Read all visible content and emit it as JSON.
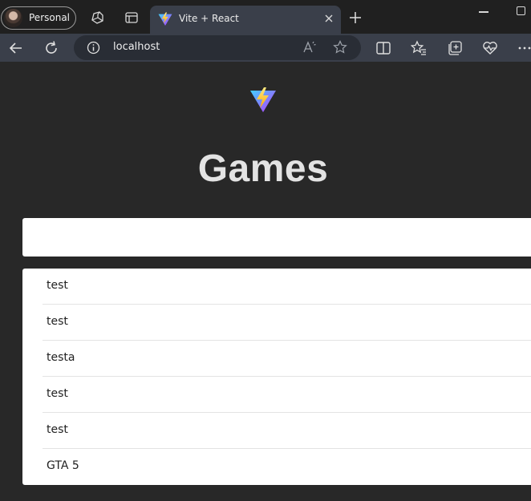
{
  "browser": {
    "profile_label": "Personal",
    "tab_title": "Vite + React",
    "address": "localhost",
    "icons": [
      "avatar",
      "workspaces-icon",
      "tab-actions-icon",
      "vite-favicon-icon",
      "close-icon",
      "new-tab-icon",
      "minimize-icon",
      "maximize-icon",
      "back-icon",
      "refresh-icon",
      "info-icon",
      "read-aloud-icon",
      "favorite-star-icon",
      "split-screen-icon",
      "favorites-icon",
      "collections-icon",
      "browser-essentials-icon",
      "more-icon"
    ]
  },
  "page": {
    "heading": "Games",
    "search_value": "",
    "games": [
      "test",
      "test",
      "testa",
      "test",
      "test",
      "GTA 5"
    ]
  },
  "colors": {
    "page_bg": "#282828",
    "chrome_tab": "#3a3f4a",
    "titlebar": "#202020",
    "card": "#ffffff"
  }
}
